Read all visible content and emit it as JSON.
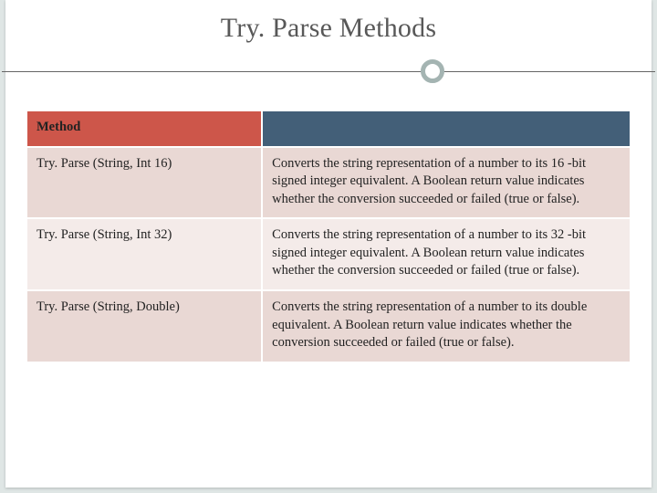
{
  "title": "Try. Parse Methods",
  "headers": {
    "c0": "Method",
    "c1": ""
  },
  "rows": [
    {
      "method": "Try. Parse (String, Int 16)",
      "desc": "Converts the string representation of a number to its 16 -bit signed integer equivalent. A Boolean return value indicates whether the conversion succeeded or failed (true or false)."
    },
    {
      "method": "Try. Parse (String, Int 32)",
      "desc": "Converts the string representation of a number to its 32 -bit signed integer equivalent. A Boolean return value indicates whether the conversion succeeded or failed (true or false)."
    },
    {
      "method": "Try. Parse (String, Double)",
      "desc": "Converts the string representation of a number to its double equivalent. A Boolean return value indicates whether the conversion succeeded or failed (true or false)."
    }
  ]
}
